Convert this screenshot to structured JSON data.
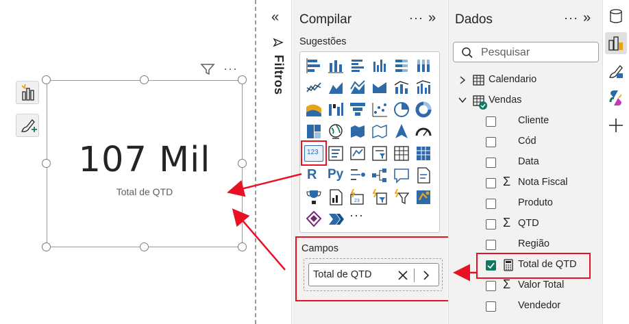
{
  "canvas": {
    "card": {
      "value": "107 Mil",
      "label": "Total de QTD"
    }
  },
  "filters": {
    "label": "Filtros"
  },
  "build_pane": {
    "title": "Compilar",
    "suggestions_label": "Sugestões",
    "more_label": "···",
    "campos": {
      "label": "Campos",
      "field": "Total de QTD"
    },
    "python_label": "Py",
    "r_label": "R",
    "kpi_label": "123"
  },
  "data_pane": {
    "title": "Dados",
    "search_placeholder": "Pesquisar",
    "tables": [
      {
        "name": "Calendario",
        "expanded": false
      },
      {
        "name": "Vendas",
        "expanded": true
      }
    ],
    "fields": [
      {
        "name": "Cliente",
        "sigma": false,
        "checked": false
      },
      {
        "name": "Cód",
        "sigma": false,
        "checked": false
      },
      {
        "name": "Data",
        "sigma": false,
        "checked": false
      },
      {
        "name": "Nota Fiscal",
        "sigma": true,
        "checked": false
      },
      {
        "name": "Produto",
        "sigma": false,
        "checked": false
      },
      {
        "name": "QTD",
        "sigma": true,
        "checked": false
      },
      {
        "name": "Região",
        "sigma": false,
        "checked": false
      },
      {
        "name": "Total de QTD",
        "sigma": false,
        "measure": true,
        "checked": true
      },
      {
        "name": "Valor Total",
        "sigma": true,
        "checked": false
      },
      {
        "name": "Vendedor",
        "sigma": false,
        "checked": false
      }
    ]
  },
  "colors": {
    "accent_red": "#e81123",
    "check_green": "#117865",
    "pane_bg": "#f3f2f1",
    "viz_blue": "#2f6aa8"
  }
}
